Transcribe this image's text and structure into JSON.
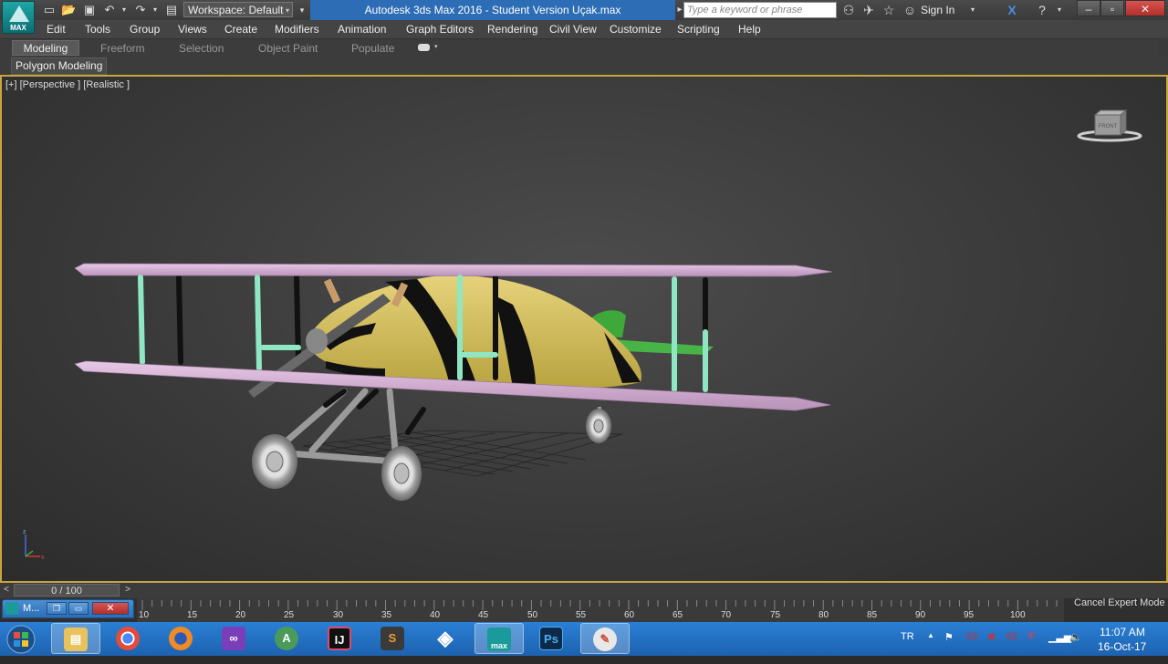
{
  "app": {
    "logo_label": "MAX",
    "title": "Autodesk 3ds Max 2016 - Student Version    Uçak.max",
    "workspace": "Workspace: Default",
    "search_placeholder": "Type a keyword or phrase",
    "sign_in": "Sign In",
    "accent_color": "#2d6db5"
  },
  "menu": [
    "Edit",
    "Tools",
    "Group",
    "Views",
    "Create",
    "Modifiers",
    "Animation",
    "Graph Editors",
    "Rendering",
    "Civil View",
    "Customize",
    "Scripting",
    "Help"
  ],
  "ribbon": {
    "tabs": [
      "Modeling",
      "Freeform",
      "Selection",
      "Object Paint",
      "Populate"
    ],
    "active_tab": "Modeling",
    "panel": "Polygon Modeling"
  },
  "viewport": {
    "label": "[+] [Perspective ] [Realistic ]",
    "viewcube_label": "FRONT",
    "shading": "Realistic",
    "border_color": "#c7a540"
  },
  "timeline": {
    "slider": "0 / 100",
    "prev": "<",
    "next": ">",
    "ticks": [
      "10",
      "15",
      "20",
      "25",
      "30",
      "35",
      "40",
      "45",
      "50",
      "55",
      "60",
      "65",
      "70",
      "75",
      "80",
      "85",
      "90",
      "95",
      "100"
    ],
    "cancel_expert": "Cancel Expert Mode"
  },
  "minimized_window": {
    "title": "M..."
  },
  "taskbar": {
    "apps": [
      "explorer",
      "chrome",
      "firefox",
      "visual-studio",
      "android-studio",
      "intellij",
      "sublime-text",
      "unity",
      "3ds-max",
      "photoshop",
      "paint"
    ],
    "photoshop_label": "Ps",
    "intellij_label": "IJ",
    "sublime_label": "S",
    "max_label": "max",
    "lang": "TR",
    "tray_num_a": "63",
    "tray_num_b": "62",
    "time": "11:07 AM",
    "date": "16-Oct-17"
  }
}
